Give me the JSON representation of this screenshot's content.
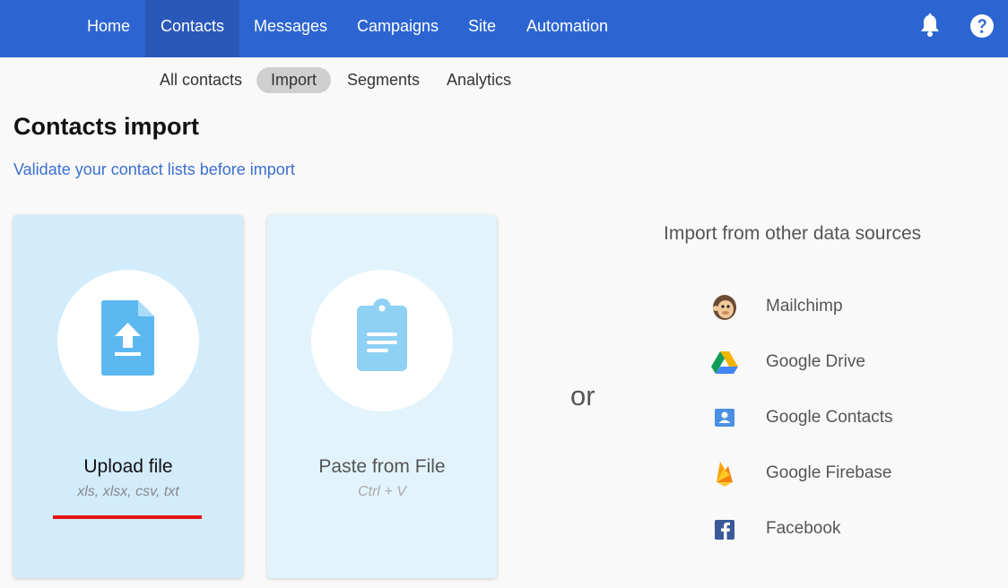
{
  "nav": {
    "items": [
      {
        "label": "Home"
      },
      {
        "label": "Contacts"
      },
      {
        "label": "Messages"
      },
      {
        "label": "Campaigns"
      },
      {
        "label": "Site"
      },
      {
        "label": "Automation"
      }
    ],
    "active": "Contacts"
  },
  "icons": {
    "notifications": "bell-icon",
    "help": "question-circle-icon"
  },
  "subnav": {
    "items": [
      {
        "label": "All contacts"
      },
      {
        "label": "Import"
      },
      {
        "label": "Segments"
      },
      {
        "label": "Analytics"
      }
    ],
    "active": "Import"
  },
  "page": {
    "title": "Contacts import",
    "validate_link": "Validate your contact lists before import"
  },
  "cards": {
    "upload": {
      "title": "Upload file",
      "subtitle": "xls, xlsx, csv, txt",
      "icon": "file-upload-icon"
    },
    "paste": {
      "title": "Paste from File",
      "subtitle": "Ctrl + V",
      "icon": "clipboard-icon"
    }
  },
  "or_label": "or",
  "sources": {
    "title": "Import from other data sources",
    "items": [
      {
        "label": "Mailchimp",
        "icon": "mailchimp-icon"
      },
      {
        "label": "Google Drive",
        "icon": "google-drive-icon"
      },
      {
        "label": "Google Contacts",
        "icon": "google-contacts-icon"
      },
      {
        "label": "Google Firebase",
        "icon": "firebase-icon"
      },
      {
        "label": "Facebook",
        "icon": "facebook-icon"
      }
    ]
  },
  "colors": {
    "topbar": "#2c65d1",
    "link": "#3b6fd1",
    "highlight_underline": "#e31414",
    "upload_card_bg": "#d2ecfc",
    "paste_card_bg": "#e2f3fb"
  }
}
